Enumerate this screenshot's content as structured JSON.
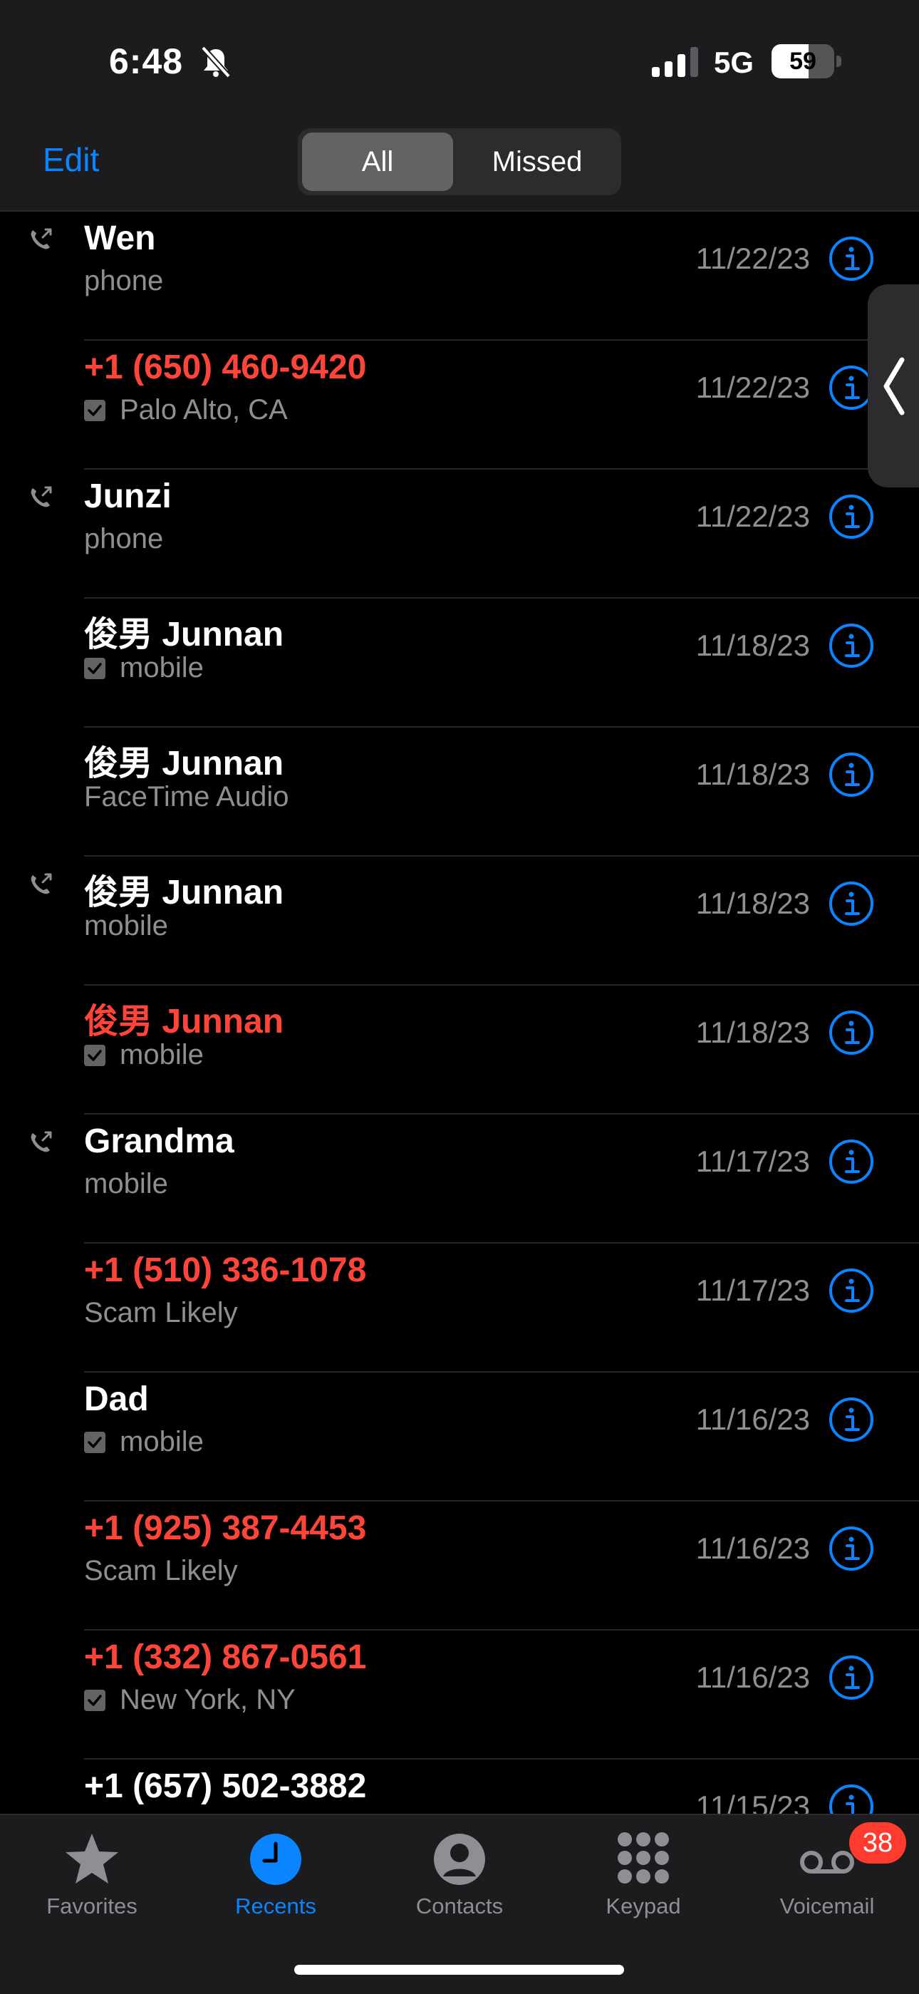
{
  "status_bar": {
    "time": "6:48",
    "network": "5G",
    "battery": "59",
    "battery_level": 0.59
  },
  "header": {
    "edit_label": "Edit",
    "segments": [
      "All",
      "Missed"
    ],
    "selected_segment": "All"
  },
  "calls": [
    {
      "name": "Wen",
      "detail": "phone",
      "date": "11/22/23",
      "missed": false,
      "outgoing": true,
      "checked": false
    },
    {
      "name": "+1 (650) 460-9420",
      "detail": "Palo Alto, CA",
      "date": "11/22/23",
      "missed": true,
      "outgoing": false,
      "checked": true
    },
    {
      "name": "Junzi",
      "detail": "phone",
      "date": "11/22/23",
      "missed": false,
      "outgoing": true,
      "checked": false
    },
    {
      "name": "俊男 Junnan",
      "detail": "mobile",
      "date": "11/18/23",
      "missed": false,
      "outgoing": false,
      "checked": true
    },
    {
      "name": "俊男 Junnan",
      "detail": "FaceTime Audio",
      "date": "11/18/23",
      "missed": false,
      "outgoing": false,
      "checked": false
    },
    {
      "name": "俊男 Junnan",
      "detail": "mobile",
      "date": "11/18/23",
      "missed": false,
      "outgoing": true,
      "checked": false
    },
    {
      "name": "俊男 Junnan",
      "detail": "mobile",
      "date": "11/18/23",
      "missed": true,
      "outgoing": false,
      "checked": true
    },
    {
      "name": "Grandma",
      "detail": "mobile",
      "date": "11/17/23",
      "missed": false,
      "outgoing": true,
      "checked": false
    },
    {
      "name": "+1 (510) 336-1078",
      "detail": "Scam Likely",
      "date": "11/17/23",
      "missed": true,
      "outgoing": false,
      "checked": false
    },
    {
      "name": "Dad",
      "detail": "mobile",
      "date": "11/16/23",
      "missed": false,
      "outgoing": false,
      "checked": true
    },
    {
      "name": "+1 (925) 387-4453",
      "detail": "Scam Likely",
      "date": "11/16/23",
      "missed": true,
      "outgoing": false,
      "checked": false
    },
    {
      "name": "+1 (332) 867-0561",
      "detail": "New York, NY",
      "date": "11/16/23",
      "missed": true,
      "outgoing": false,
      "checked": true
    },
    {
      "name": "+1 (657) 502-3882",
      "detail": "",
      "date": "11/15/23",
      "missed": false,
      "outgoing": false,
      "checked": false
    }
  ],
  "tabbar": {
    "tabs": [
      {
        "label": "Favorites",
        "icon": "star-icon"
      },
      {
        "label": "Recents",
        "icon": "clock-icon"
      },
      {
        "label": "Contacts",
        "icon": "person-circle-icon"
      },
      {
        "label": "Keypad",
        "icon": "keypad-icon"
      },
      {
        "label": "Voicemail",
        "icon": "voicemail-icon"
      }
    ],
    "active": "Recents",
    "voicemail_badge": "38"
  },
  "colors": {
    "accent": "#0a84ff",
    "missed": "#ff453a",
    "secondary_text": "#8e8e93",
    "badge": "#ff3b30"
  }
}
